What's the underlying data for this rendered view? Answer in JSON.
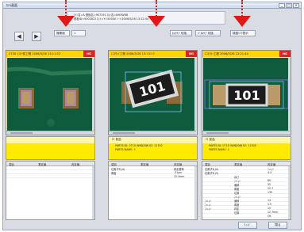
{
  "window": {
    "title": "ｶﾒﾗ画面",
    "min_label": "_",
    "max_label": "□",
    "close_label": "x"
  },
  "info_bar": {
    "line1": "ﾗｲﾝ名=A 基板名=9S7191 ﾛｯﾄ名=NH3W8B",
    "line2": "基板ID=9002822 ﾛｯﾄ=Y=50000 ｼｰﾄ:2006/5/26 13:12:44",
    "line3": ""
  },
  "nav": {
    "prev_label": "◀",
    "next_label": "▶"
  },
  "controls": {
    "camera_select_label": "撮像面",
    "camera_select_value": "1",
    "capture_button_label": "ｶﾒﾗｻﾌﾞ切換",
    "panel_button_label": "ﾊﾟﾈﾙｻﾌﾞ切換",
    "right_select_value": "検査ｴﾘｱ表示"
  },
  "panels": [
    {
      "header": "2730 ﾘﾌﾛｰ前工程  2006/5/26 13:11:52",
      "status": "NG",
      "checkbox_label": "",
      "parts_line": "",
      "line2": "",
      "table_cols": [
        "項目",
        "測定値",
        "判定値"
      ],
      "rows": [
        [
          "",
          "",
          ""
        ],
        [
          "",
          "",
          ""
        ],
        [
          "",
          "",
          ""
        ]
      ]
    },
    {
      "header": "ｴｺﾏｳﾝﾄ工程  2006/5/26 13:13:17",
      "status": "NG",
      "checkbox_label": "良品",
      "parts_line": "PARTS ID: 0710  WIND0W ID: 11302",
      "line2": "PARTS NAME: 1",
      "table_cols": [
        "項目",
        "測定値",
        "判定値"
      ],
      "rows": [
        [
          "位置ずれ(X)",
          "",
          "判定基準"
        ],
        [
          "角度",
          "",
          "-31µm"
        ],
        [
          "",
          "",
          "12.3mm"
        ]
      ]
    },
    {
      "header": "ｴｺﾘﾌﾛｰ工程  2006/5/26 13:21:44",
      "status": "NG",
      "checkbox_label": "良品",
      "parts_line": "PARTS ID: 0710  WIND0W ID: 11305",
      "line2": "PARTS NAME: 1",
      "table_cols": [
        "項目",
        "測定値",
        "判定値"
      ],
      "rows": [
        [
          "位置ずれ(X)",
          "",
          "ﾌｨﾚｯﾄ"
        ],
        [
          "位置ずれ(Y)",
          "",
          "4.4"
        ],
        [
          "",
          "高さ",
          ""
        ],
        [
          "",
          "ﾌｨﾚｯﾄ",
          "60"
        ],
        [
          "",
          "面積",
          "52"
        ],
        [
          "",
          "角度",
          "12.7"
        ],
        [
          "",
          "位置",
          "135"
        ],
        [
          "",
          "ﾌｨﾚｯﾄ",
          ""
        ],
        [
          "ﾌｨﾚｯﾄ",
          "面積",
          "14"
        ],
        [
          "ﾌｨﾚｯﾄ",
          "角度",
          "1.5"
        ],
        [
          "ﾌｨﾚｯﾄ",
          "判定",
          "15"
        ],
        [
          "",
          "位置",
          "12.7mm"
        ],
        [
          "",
          "",
          "OK"
        ]
      ]
    }
  ],
  "footer": {
    "ok_button_label": "ｳｨﾝﾄﾞ",
    "close_button_label": "閉る"
  },
  "chip_marking": "101",
  "colors": {
    "header_yellow": "#ffd400",
    "ng_red": "#e52222",
    "annotation_arrow": "#e01818",
    "pcb_green": "#0e5a3c"
  }
}
